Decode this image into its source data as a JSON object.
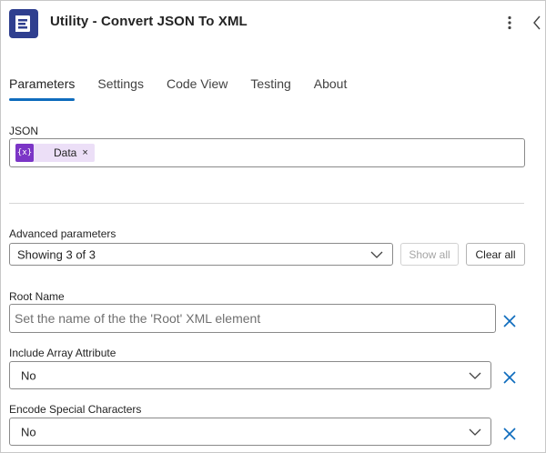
{
  "header": {
    "title": "Utility - Convert JSON To XML",
    "app_icon": "document-convert-icon",
    "more_icon": "more-vertical-icon",
    "collapse_icon": "chevron-left-icon"
  },
  "tabs": [
    {
      "label": "Parameters",
      "active": true
    },
    {
      "label": "Settings",
      "active": false
    },
    {
      "label": "Code View",
      "active": false
    },
    {
      "label": "Testing",
      "active": false
    },
    {
      "label": "About",
      "active": false
    }
  ],
  "json_field": {
    "label": "JSON",
    "token": {
      "icon_text": "{x}",
      "label": "Data",
      "remove_symbol": "×"
    }
  },
  "advanced": {
    "label": "Advanced parameters",
    "selected": "Showing 3 of 3",
    "show_all_label": "Show all",
    "clear_all_label": "Clear all"
  },
  "root_name": {
    "label": "Root Name",
    "value": "",
    "placeholder": "Set the name of the the 'Root' XML element"
  },
  "include_array": {
    "label": "Include Array Attribute",
    "selected": "No"
  },
  "encode_special": {
    "label": "Encode Special Characters",
    "selected": "No"
  },
  "colors": {
    "accent": "#0f6cbd",
    "token_bg": "#ecdff7",
    "token_icon_bg": "#7b35c6",
    "app_icon_bg": "#2f3f8f"
  }
}
